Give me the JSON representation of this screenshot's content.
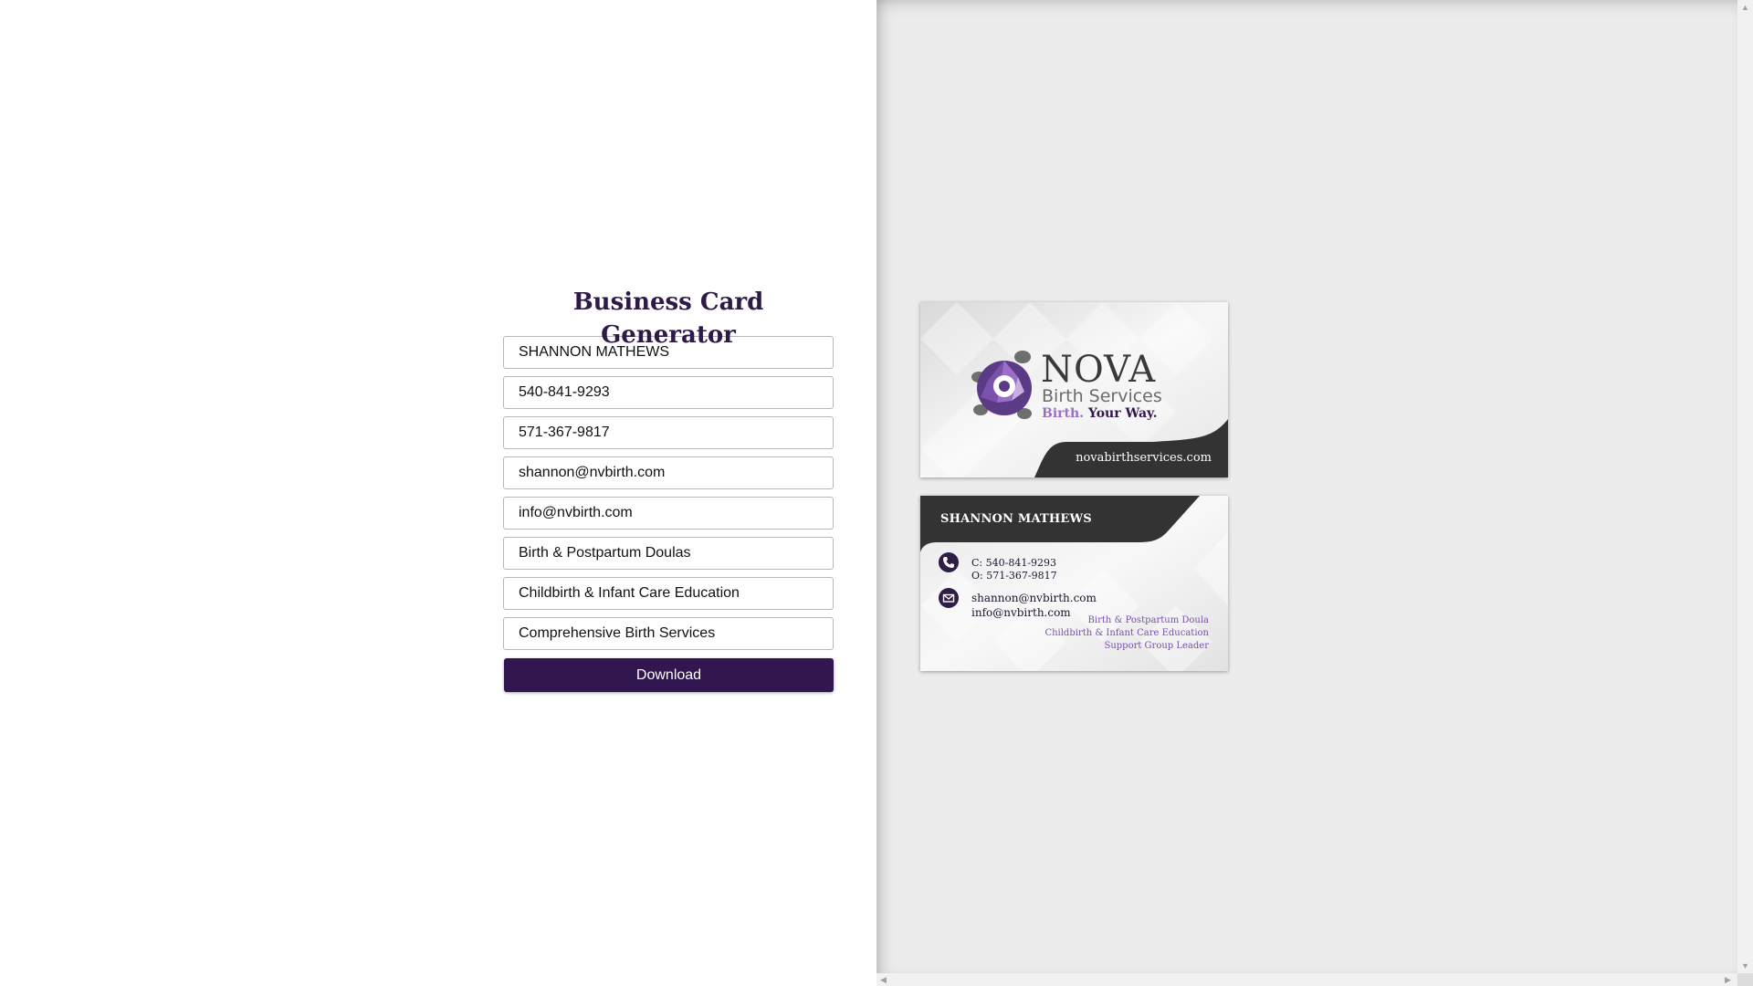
{
  "form": {
    "title": "Business Card Generator",
    "fields": {
      "name": "SHANNON MATHEWS",
      "cell_phone": "540-841-9293",
      "office_phone": "571-367-9817",
      "email_primary": "shannon@nvbirth.com",
      "email_secondary": "info@nvbirth.com",
      "service_1": "Birth & Postpartum Doulas",
      "service_2": "Childbirth & Infant Care Education",
      "service_3": "Comprehensive Birth Services"
    },
    "download_label": "Download"
  },
  "card_front": {
    "logo_title": "NOVA",
    "logo_subtitle": "Birth Services",
    "tagline_part1": "Birth.",
    "tagline_part2": "Your Way.",
    "website": "novabirthservices.com"
  },
  "card_back": {
    "name": "SHANNON MATHEWS",
    "cell_line": "C: 540-841-9293",
    "office_line": "O: 571-367-9817",
    "email_line_1": "shannon@nvbirth.com",
    "email_line_2": "info@nvbirth.com",
    "services": [
      "Birth & Postpartum Doula",
      "Childbirth & Infant Care Education",
      "Support Group Leader"
    ]
  },
  "colors": {
    "brand_purple": "#31164f",
    "accent_lavender": "#9b6fc9",
    "card_dark": "#333333",
    "title_purple": "#2e1a47"
  },
  "icons": {
    "phone": "phone-icon",
    "mail": "mail-icon",
    "logo": "turtle-logo-icon"
  }
}
